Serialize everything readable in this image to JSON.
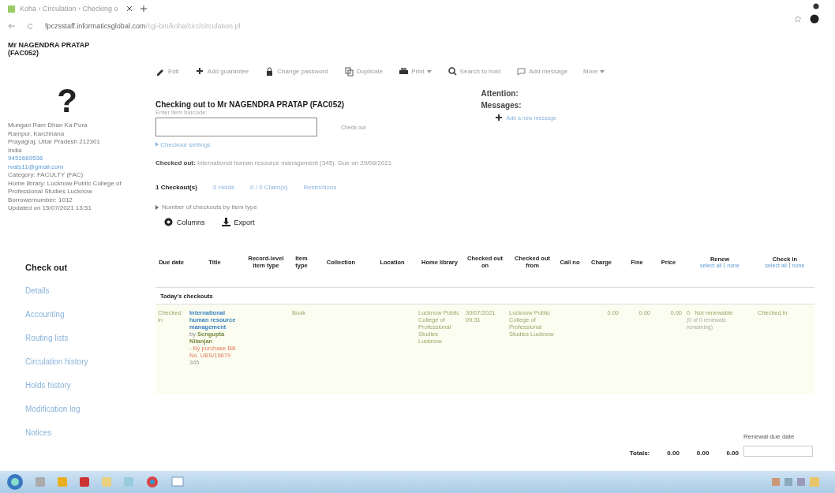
{
  "browser": {
    "tab_title": "Koha › Circulation › Checking o",
    "url_host": "fpczsstaff.informaticsglobal.com",
    "url_path": "/cgi-bin/koha/circ/circulation.pl"
  },
  "patron": {
    "name": "Mr NAGENDRA PRATAP (FAC052)",
    "photo": "?",
    "details": [
      {
        "kind": "text",
        "text": "Mungari Ram Dhan Ka Pura"
      },
      {
        "kind": "text",
        "text": "Rampur, Karchhana"
      },
      {
        "kind": "text",
        "text": "Prayagraj, Uttar Pradesh 212301"
      },
      {
        "kind": "text",
        "text": "India"
      },
      {
        "kind": "link",
        "text": "9451669536"
      },
      {
        "kind": "link",
        "text": "rvats11@gmail.com"
      },
      {
        "kind": "text",
        "text": "Category: FACULTY (FAC)"
      },
      {
        "kind": "text",
        "text": "Home library: Lucknow Public College of Professional Studies Lucknow"
      },
      {
        "kind": "text",
        "text": "Borrowernumber: 1012"
      },
      {
        "kind": "text",
        "text": "Updated on 15/07/2021 13:51"
      }
    ]
  },
  "menu": [
    {
      "label": "Check out",
      "selected": true
    },
    {
      "label": "Details",
      "selected": false
    },
    {
      "label": "Accounting",
      "selected": false
    },
    {
      "label": "Routing lists",
      "selected": false
    },
    {
      "label": "Circulation history",
      "selected": false
    },
    {
      "label": "Holds history",
      "selected": false
    },
    {
      "label": "Modification log",
      "selected": false
    },
    {
      "label": "Notices",
      "selected": false
    }
  ],
  "toolbar": [
    {
      "label": "Edit",
      "dropdown": false
    },
    {
      "label": "Add guarantee",
      "dropdown": false
    },
    {
      "label": "Change password",
      "dropdown": false
    },
    {
      "label": "Duplicate",
      "dropdown": false
    },
    {
      "label": "Print",
      "dropdown": true
    },
    {
      "label": "Search to hold",
      "dropdown": false
    },
    {
      "label": "Add message",
      "dropdown": false
    },
    {
      "label": "More",
      "dropdown": true
    }
  ],
  "checkout": {
    "title": "Checking out to Mr NAGENDRA PRATAP (FAC052)",
    "field_label": "Enter item barcode:",
    "button": "Check out",
    "settings": "Checkout settings",
    "last_label": "Checked out:",
    "last_text": "International human resource management (345). Due on 29/08/2021"
  },
  "attention": {
    "title": "Attention:",
    "messages_title": "Messages:",
    "add_message": "Add a new message"
  },
  "tabs": [
    {
      "label": "1 Checkout(s)",
      "selected": true
    },
    {
      "label": "0 Holds",
      "selected": false
    },
    {
      "label": "0 / 0 Claim(s)",
      "selected": false
    },
    {
      "label": "Restrictions",
      "selected": false
    }
  ],
  "by_type": "Number of checkouts by item type",
  "table_tools": [
    {
      "label": "Columns"
    },
    {
      "label": "Export"
    }
  ],
  "table": {
    "columns": [
      {
        "label": "Due date"
      },
      {
        "label": "Title"
      },
      {
        "label": "Record-level item type"
      },
      {
        "label": "Item type"
      },
      {
        "label": "Collection"
      },
      {
        "label": "Location"
      },
      {
        "label": "Home library"
      },
      {
        "label": "Checked out on"
      },
      {
        "label": "Checked out from"
      },
      {
        "label": "Call no"
      },
      {
        "label": "Charge"
      },
      {
        "label": "Fine"
      },
      {
        "label": "Price"
      },
      {
        "label": "Renew",
        "select_all": "select all",
        "select_none": "none"
      },
      {
        "label": "Check in",
        "select_all": "select all",
        "select_none": "none"
      }
    ],
    "group": "Today's checkouts",
    "row": {
      "due": "Checked in",
      "title": "International human resource management",
      "author_by": "by",
      "author": "Sengupta Nilanjan",
      "note": "- By purchase Bill No. UBS/15679",
      "barcode": "345",
      "item_type": "Book",
      "home_library": "Lucknow Public College of Professional Studies Lucknow",
      "checked_out_on": "30/07/2021 09:31",
      "checked_out_from": "Lucknow Public College of Professional Studies Lucknow",
      "charge": "0.00",
      "fine": "0.00",
      "price": "0.00",
      "renew_count": "0",
      "renew_status": "Not renewable",
      "renew_remaining": "(0 of 0 renewals remaining)",
      "check_in": "Checked in"
    },
    "totals_label": "Totals:",
    "totals": [
      "0.00",
      "0.00",
      "0.00"
    ],
    "renewal_label": "Renewal due date"
  }
}
